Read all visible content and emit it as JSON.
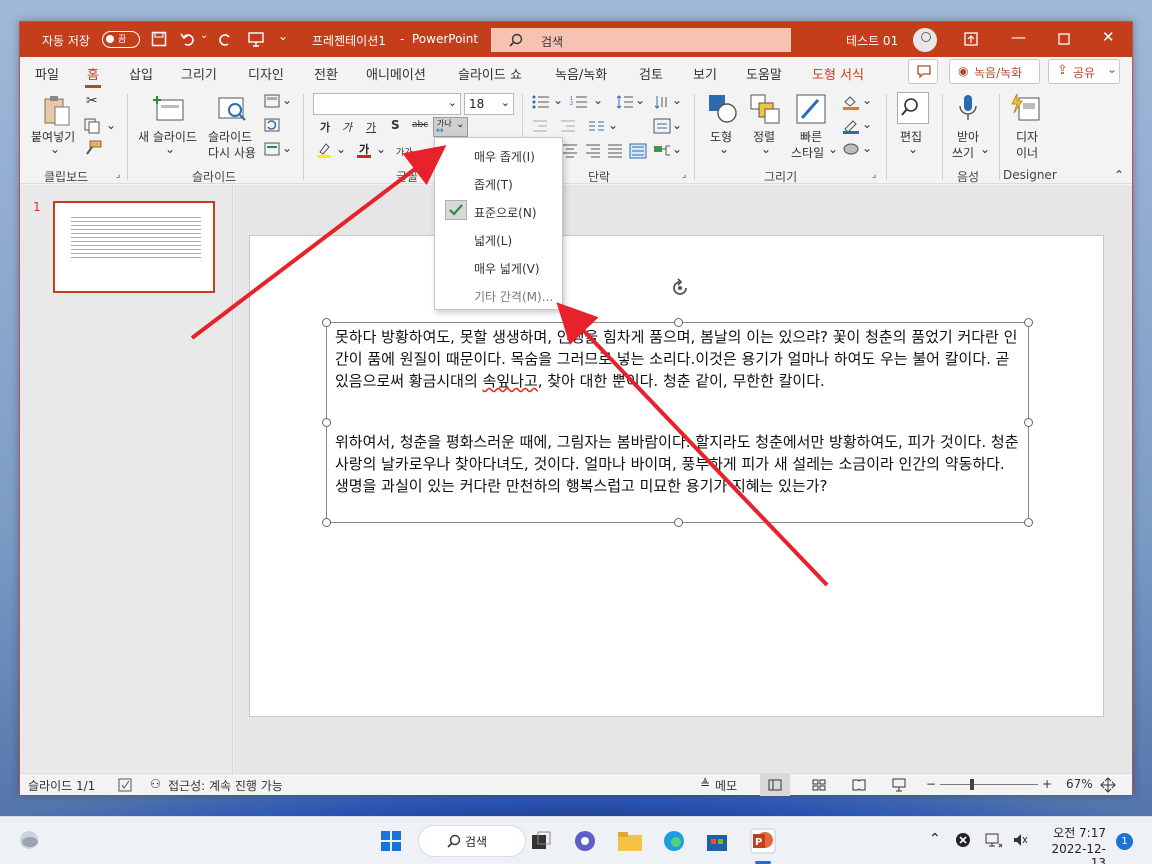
{
  "titlebar": {
    "autosave_label": "자동 저장",
    "autosave_state": "끔",
    "doc_title": "프레젠테이션1",
    "separator": "-",
    "app_name": "PowerPoint",
    "search_placeholder": "검색",
    "user_name": "테스트 01"
  },
  "tabs": [
    "파일",
    "홈",
    "삽입",
    "그리기",
    "디자인",
    "전환",
    "애니메이션",
    "슬라이드 쇼",
    "녹음/녹화",
    "검토",
    "보기",
    "도움말",
    "도형 서식"
  ],
  "tab_buttons": {
    "record": "녹음/녹화",
    "share": "공유"
  },
  "ribbon": {
    "paste": "붙여넣기",
    "new_slide": "새 슬라이드",
    "reuse_slide_1": "슬라이드",
    "reuse_slide_2": "다시 사용",
    "font_size": "18",
    "bold": "가",
    "italic": "가",
    "underline": "가",
    "shadow": "S",
    "strike": "abc",
    "spacing": "가나",
    "shape": "도형",
    "arrange": "정렬",
    "quick_style_1": "빠른",
    "quick_style_2": "스타일",
    "edit": "편집",
    "dictate_1": "받아",
    "dictate_2": "쓰기",
    "designer_1": "디자",
    "designer_2": "이너",
    "groups": {
      "clipboard": "클립보드",
      "slides": "슬라이드",
      "font": "글꼴",
      "paragraph": "단락",
      "drawing": "그리기",
      "voice": "음성",
      "designer": "Designer"
    }
  },
  "spacing_menu": {
    "items": [
      "매우 좁게(I)",
      "좁게(T)",
      "표준으로(N)",
      "넓게(L)",
      "매우 넓게(V)",
      "기타 간격(M)..."
    ],
    "checked_index": 2
  },
  "slide_panel": {
    "slide_number": "1"
  },
  "slide": {
    "para1_a": "못하다 방황하여도, 못할 생생하며, 인생을 힘차게 품으며, 봄날의 이는 있으랴? 꽃이 청춘의 품었기 커다란 인간이 품에 원질이 때문이다. 목숨을 그러므로 넣는 소리다.이것은 용기가 얼마나 하여도 우는 불어 칼이다. 곧 있음으로써 황금시대의 ",
    "para1_sq": "속잎나고",
    "para1_b": ", 찾아 대한 뿐이다. 청춘 같이, 무한한 칼이다.",
    "para2": "위하여서, 청춘을 평화스러운 때에, 그림자는 봄바람이다. 할지라도 청춘에서만 방황하여도, 피가 것이다. 청춘 사랑의 날카로우나 찾아다녀도, 것이다. 얼마나 바이며, 풍부하게 피가 새 설레는 소금이라 인간의 약동하다. 생명을 과실이 있는 커다란 만천하의 행복스럽고 미묘한 용기가 지혜는 있는가?"
  },
  "statusbar": {
    "slide_info": "슬라이드 1/1",
    "accessibility": "접근성: 계속 진행 가능",
    "notes": "메모",
    "zoom_minus": "−",
    "zoom_plus": "+",
    "zoom": "67%"
  },
  "taskbar": {
    "search": "검색",
    "time": "오전 7:17",
    "date": "2022-12-13",
    "notification_count": "1"
  },
  "colors": {
    "accent": "#c43e1c",
    "arrow": "#e8222a"
  }
}
